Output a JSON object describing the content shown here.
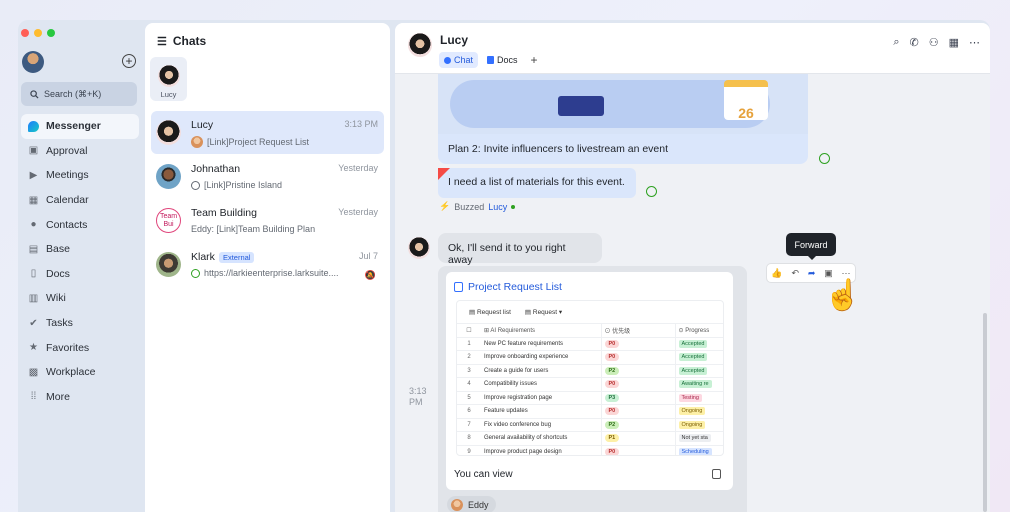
{
  "sidebar": {
    "search_label": "Search (⌘+K)",
    "items": [
      {
        "label": "Messenger",
        "icon": "messenger-icon"
      },
      {
        "label": "Approval",
        "icon": "approval-icon"
      },
      {
        "label": "Meetings",
        "icon": "video-icon"
      },
      {
        "label": "Calendar",
        "icon": "calendar-icon"
      },
      {
        "label": "Contacts",
        "icon": "contacts-icon"
      },
      {
        "label": "Base",
        "icon": "base-icon"
      },
      {
        "label": "Docs",
        "icon": "docs-icon"
      },
      {
        "label": "Wiki",
        "icon": "wiki-icon"
      },
      {
        "label": "Tasks",
        "icon": "tasks-icon"
      },
      {
        "label": "Favorites",
        "icon": "star-icon"
      },
      {
        "label": "Workplace",
        "icon": "workplace-icon"
      },
      {
        "label": "More",
        "icon": "grid-icon"
      }
    ]
  },
  "chatlist": {
    "title": "Chats",
    "pinned_label": "Lucy",
    "chats": [
      {
        "name": "Lucy",
        "time": "3:13 PM",
        "preview": "[Link]Project Request List"
      },
      {
        "name": "Johnathan",
        "time": "Yesterday",
        "preview": "[Link]Pristine Island"
      },
      {
        "name": "Team Building",
        "time": "Yesterday",
        "preview": "Eddy: [Link]Team Building Plan",
        "avatar_text": "Team Bui"
      },
      {
        "name": "Klark",
        "time": "Jul 7",
        "preview": "https://larkieenterprise.larksuite....",
        "badge": "External"
      }
    ]
  },
  "conversation": {
    "title": "Lucy",
    "tabs": [
      "Chat",
      "Docs"
    ],
    "tab_add": "+",
    "messages": {
      "plan": "Plan 2: Invite influencers to livestream an event",
      "need": "I need a list of materials for this event.",
      "buzzed_label": "Buzzed",
      "buzzed_name": "Lucy",
      "reply": "Ok, I'll send it to you right away",
      "calendar_day": "26"
    },
    "card": {
      "title": "Project Request List",
      "sheet_tab1": "Request list",
      "sheet_tab2": "Request",
      "col_requirements": "AI Requirements",
      "col_priority": "优先级",
      "col_progress": "Progress",
      "rows": [
        {
          "num": "1",
          "req": "New PC feature requirements",
          "pri": "P0",
          "prog": "Accepted"
        },
        {
          "num": "2",
          "req": "Improve onboarding experience",
          "pri": "P0",
          "prog": "Accepted"
        },
        {
          "num": "3",
          "req": "Create a guide for users",
          "pri": "P2",
          "prog": "Accepted"
        },
        {
          "num": "4",
          "req": "Compatibility issues",
          "pri": "P0",
          "prog": "Awaiting re"
        },
        {
          "num": "5",
          "req": "Improve registration page",
          "pri": "P3",
          "prog": "Testing"
        },
        {
          "num": "6",
          "req": "Feature updates",
          "pri": "P0",
          "prog": "Ongoing"
        },
        {
          "num": "7",
          "req": "Fix video conference bug",
          "pri": "P2",
          "prog": "Ongoing"
        },
        {
          "num": "8",
          "req": "General availability of shortcuts",
          "pri": "P1",
          "prog": "Not yet sta"
        },
        {
          "num": "9",
          "req": "Improve product page design",
          "pri": "P0",
          "prog": "Scheduling"
        }
      ],
      "footer": "You can view"
    },
    "chip_name": "Eddy",
    "timestamp": "3:13 PM",
    "tooltip": "Forward"
  }
}
